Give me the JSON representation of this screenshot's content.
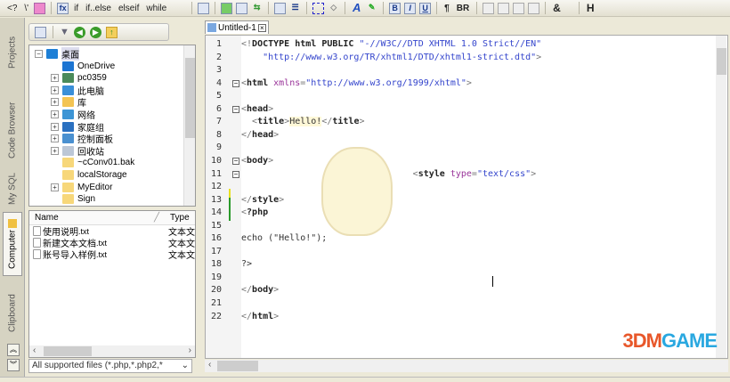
{
  "toolbar": {
    "items": [
      "<?",
      "\\'",
      "fx",
      "if",
      "if..else",
      "elseif",
      "while",
      "¶",
      "BR",
      "&",
      "H"
    ],
    "bold": "B",
    "italic": "I",
    "underline": "U"
  },
  "side_tabs": [
    "Projects",
    "Code Browser",
    "My SQL",
    "Computer",
    "Clipboard"
  ],
  "tree": [
    {
      "label": "桌面",
      "expand": "−",
      "color": "#1e7fd6"
    },
    {
      "label": "OneDrive",
      "expand": "",
      "color": "#1c74d2"
    },
    {
      "label": "pc0359",
      "expand": "+",
      "color": "#4a8a5a"
    },
    {
      "label": "此电脑",
      "expand": "+",
      "color": "#3a8fd8"
    },
    {
      "label": "库",
      "expand": "+",
      "color": "#f3c453"
    },
    {
      "label": "网络",
      "expand": "+",
      "color": "#3d95d5"
    },
    {
      "label": "家庭组",
      "expand": "+",
      "color": "#2a70c0"
    },
    {
      "label": "控制面板",
      "expand": "+",
      "color": "#4a90d0"
    },
    {
      "label": "回收站",
      "expand": "+",
      "color": "#bcc7d6"
    },
    {
      "label": "~cConv01.bak",
      "expand": "",
      "color": "#f7d77a"
    },
    {
      "label": "localStorage",
      "expand": "",
      "color": "#f7d77a"
    },
    {
      "label": "MyEditor",
      "expand": "+",
      "color": "#f7d77a"
    },
    {
      "label": "Sign",
      "expand": "",
      "color": "#f7d77a"
    }
  ],
  "files": {
    "columns": [
      "Name",
      "Type"
    ],
    "rows": [
      {
        "name": "使用说明",
        "ext": ".txt",
        "type": "文本文"
      },
      {
        "name": "新建文本文档",
        "ext": ".txt",
        "type": "文本文"
      },
      {
        "name": "账号导入样例",
        "ext": ".txt",
        "type": "文本文"
      }
    ]
  },
  "filter": "All supported files (*.php,*.php2,*",
  "editor": {
    "tab": "Untitled-1",
    "close": "×"
  },
  "code": [
    {
      "n": "1",
      "parts": [
        [
          "t",
          "<!"
        ],
        [
          "k",
          "DOCTYPE html PUBLIC "
        ],
        [
          "s",
          "\"-//W3C//DTD XHTML 1.0 Strict//EN\""
        ]
      ]
    },
    {
      "n": "2",
      "parts": [
        [
          "s",
          "    \"http://www.w3.org/TR/xhtml1/DTD/xhtml1-strict.dtd\""
        ],
        [
          "t",
          ">"
        ]
      ]
    },
    {
      "n": "3",
      "parts": []
    },
    {
      "n": "4",
      "fold": "−",
      "parts": [
        [
          "t",
          "<"
        ],
        [
          "k",
          "html "
        ],
        [
          "a",
          "xmlns"
        ],
        [
          "t",
          "="
        ],
        [
          "s",
          "\"http://www.w3.org/1999/xhtml\""
        ],
        [
          "t",
          ">"
        ]
      ]
    },
    {
      "n": "5",
      "parts": []
    },
    {
      "n": "6",
      "fold": "−",
      "parts": [
        [
          "t",
          "<"
        ],
        [
          "k",
          "head"
        ],
        [
          "t",
          ">"
        ]
      ]
    },
    {
      "n": "7",
      "parts": [
        [
          "t",
          "  <"
        ],
        [
          "k",
          "title"
        ],
        [
          "t",
          ">"
        ],
        [
          "",
          "Hello!"
        ],
        [
          "t",
          "</"
        ],
        [
          "k",
          "title"
        ],
        [
          "t",
          ">"
        ]
      ]
    },
    {
      "n": "8",
      "parts": [
        [
          "t",
          "</"
        ],
        [
          "k",
          "head"
        ],
        [
          "t",
          ">"
        ]
      ]
    },
    {
      "n": "9",
      "parts": []
    },
    {
      "n": "10",
      "fold": "−",
      "parts": [
        [
          "t",
          "<"
        ],
        [
          "k",
          "body"
        ],
        [
          "t",
          ">"
        ]
      ]
    },
    {
      "n": "11",
      "fold": "−",
      "parts": [
        [
          "t",
          "                                <"
        ],
        [
          "k",
          "style "
        ],
        [
          "a",
          "type"
        ],
        [
          "t",
          "="
        ],
        [
          "s",
          "\"text/css\""
        ],
        [
          "t",
          ">"
        ]
      ]
    },
    {
      "n": "12",
      "parts": []
    },
    {
      "n": "13",
      "parts": [
        [
          "t",
          "</"
        ],
        [
          "k",
          "style"
        ],
        [
          "t",
          ">"
        ]
      ]
    },
    {
      "n": "14",
      "parts": [
        [
          "t",
          "<"
        ],
        [
          "k",
          "?php"
        ]
      ]
    },
    {
      "n": "15",
      "parts": []
    },
    {
      "n": "16",
      "parts": [
        [
          "",
          "echo (\"Hello!\");"
        ]
      ]
    },
    {
      "n": "17",
      "parts": []
    },
    {
      "n": "18",
      "parts": [
        [
          "",
          "?>"
        ]
      ]
    },
    {
      "n": "19",
      "parts": []
    },
    {
      "n": "20",
      "parts": [
        [
          "t",
          "</"
        ],
        [
          "k",
          "body"
        ],
        [
          "t",
          ">"
        ]
      ]
    },
    {
      "n": "21",
      "parts": []
    },
    {
      "n": "22",
      "parts": [
        [
          "t",
          "</"
        ],
        [
          "k",
          "html"
        ],
        [
          "t",
          ">"
        ]
      ]
    }
  ],
  "watermark": {
    "a": "3DM",
    "b": "GAME"
  }
}
